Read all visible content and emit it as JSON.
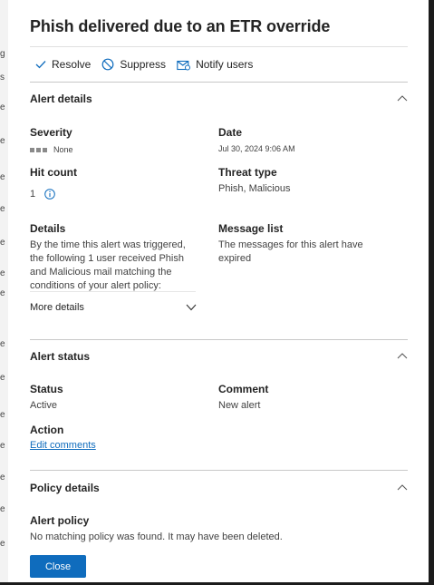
{
  "background": {
    "strip_letters": [
      "g",
      "s",
      "e",
      "e",
      "e",
      "e",
      "e",
      "e",
      "e",
      "e",
      "e",
      "e",
      "e",
      "e",
      "e",
      "e"
    ]
  },
  "panel": {
    "title": "Phish delivered due to an ETR override",
    "toolbar": {
      "resolve_label": "Resolve",
      "suppress_label": "Suppress",
      "notify_label": "Notify users"
    },
    "alert_details": {
      "heading": "Alert details",
      "severity_label": "Severity",
      "severity_value": "None",
      "date_label": "Date",
      "date_value": "Jul 30, 2024 9:06 AM",
      "hit_count_label": "Hit count",
      "hit_count_value": "1",
      "threat_type_label": "Threat type",
      "threat_type_value": "Phish, Malicious",
      "details_label": "Details",
      "details_text": "By the time this alert was triggered, the following 1 user received Phish and Malicious mail matching the conditions of your alert policy:",
      "message_list_label": "Message list",
      "message_list_text": "The messages for this alert have expired",
      "more_details_label": "More details"
    },
    "alert_status": {
      "heading": "Alert status",
      "status_label": "Status",
      "status_value": "Active",
      "comment_label": "Comment",
      "comment_value": "New alert",
      "action_label": "Action",
      "edit_comments_link": "Edit comments"
    },
    "policy_details": {
      "heading": "Policy details",
      "alert_policy_label": "Alert policy",
      "alert_policy_value": "No matching policy was found. It may have been deleted."
    },
    "close_label": "Close"
  },
  "colors": {
    "accent": "#0f6cbd",
    "backdrop": "#1b1b1b"
  }
}
